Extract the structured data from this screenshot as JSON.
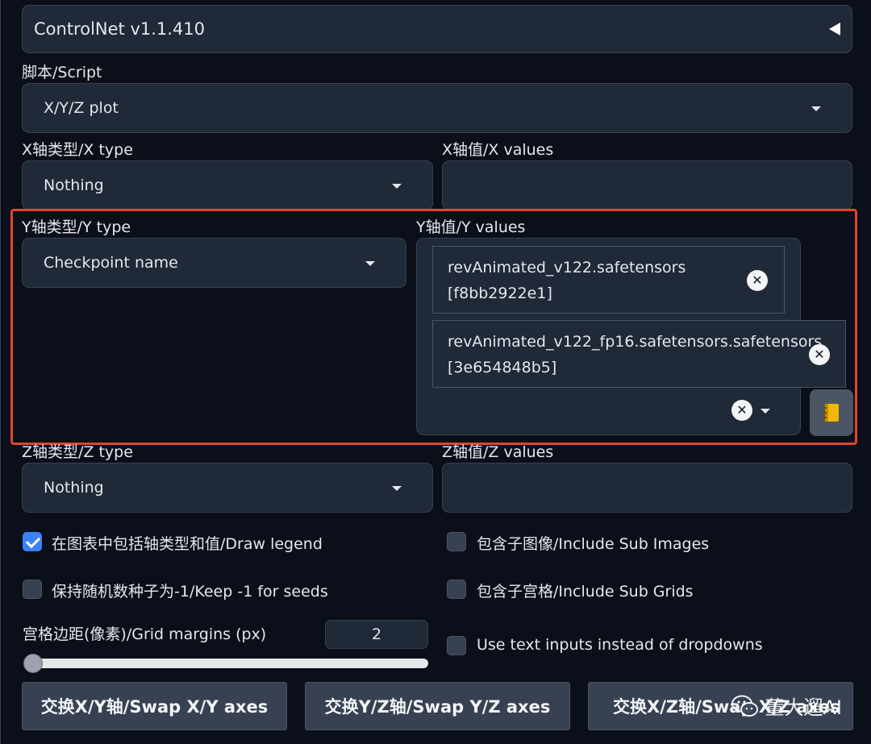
{
  "accordion": {
    "title": "ControlNet v1.1.410"
  },
  "script": {
    "label": "脚本/Script",
    "value": "X/Y/Z plot"
  },
  "x_axis": {
    "type_label": "X轴类型/X type",
    "type_value": "Nothing",
    "values_label": "X轴值/X values",
    "values_value": ""
  },
  "y_axis": {
    "type_label": "Y轴类型/Y type",
    "type_value": "Checkpoint name",
    "values_label": "Y轴值/Y values",
    "tags": [
      {
        "line1": "revAnimated_v122.safetensors",
        "line2": "[f8bb2922e1]"
      },
      {
        "line1": "revAnimated_v122_fp16.safetensors.safetensors",
        "line2": "[3e654848b5]"
      }
    ]
  },
  "z_axis": {
    "type_label": "Z轴类型/Z type",
    "type_value": "Nothing",
    "values_label": "Z轴值/Z values",
    "values_value": ""
  },
  "options": {
    "draw_legend": {
      "label": "在图表中包括轴类型和值/Draw legend",
      "checked": true
    },
    "include_sub_images": {
      "label": "包含子图像/Include Sub Images",
      "checked": false
    },
    "keep_seeds": {
      "label": "保持随机数种子为-1/Keep -1 for seeds",
      "checked": false
    },
    "include_sub_grids": {
      "label": "包含子宫格/Include Sub Grids",
      "checked": false
    },
    "text_inputs": {
      "label": "Use text inputs instead of dropdowns",
      "checked": false
    }
  },
  "grid_margins": {
    "label": "宫格边距(像素)/Grid margins (px)",
    "value": "2"
  },
  "buttons": {
    "swap_xy": "交换X/Y轴/Swap X/Y axes",
    "swap_yz": "交换Y/Z轴/Swap Y/Z axes",
    "swap_xz": "交换X/Z轴/Swap X/Z axes"
  },
  "watermark": {
    "text": "董大遛AI"
  },
  "colors": {
    "highlight": "#e0452d",
    "accent": "#3b82f6",
    "background": "#0b0f19"
  }
}
